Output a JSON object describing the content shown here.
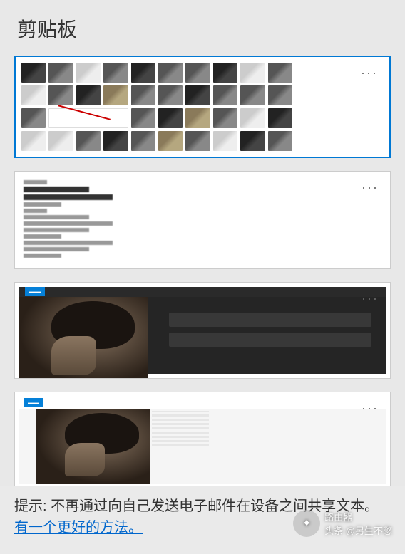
{
  "header": {
    "title": "剪贴板"
  },
  "items": [
    {
      "type": "image-grid",
      "selected": true,
      "more": "···"
    },
    {
      "type": "text-document",
      "selected": false,
      "more": "···"
    },
    {
      "type": "screenshot-dark",
      "selected": false,
      "more": "···"
    },
    {
      "type": "screenshot-light",
      "selected": false,
      "more": "···"
    }
  ],
  "tip": {
    "prefix": "提示: ",
    "text": "不再通过向自己发送电子邮件在设备之间共享文本。",
    "link_text": "有一个更好的方法。"
  },
  "watermark": {
    "line1": "路由器",
    "line2": "头条 @另生不憋"
  }
}
